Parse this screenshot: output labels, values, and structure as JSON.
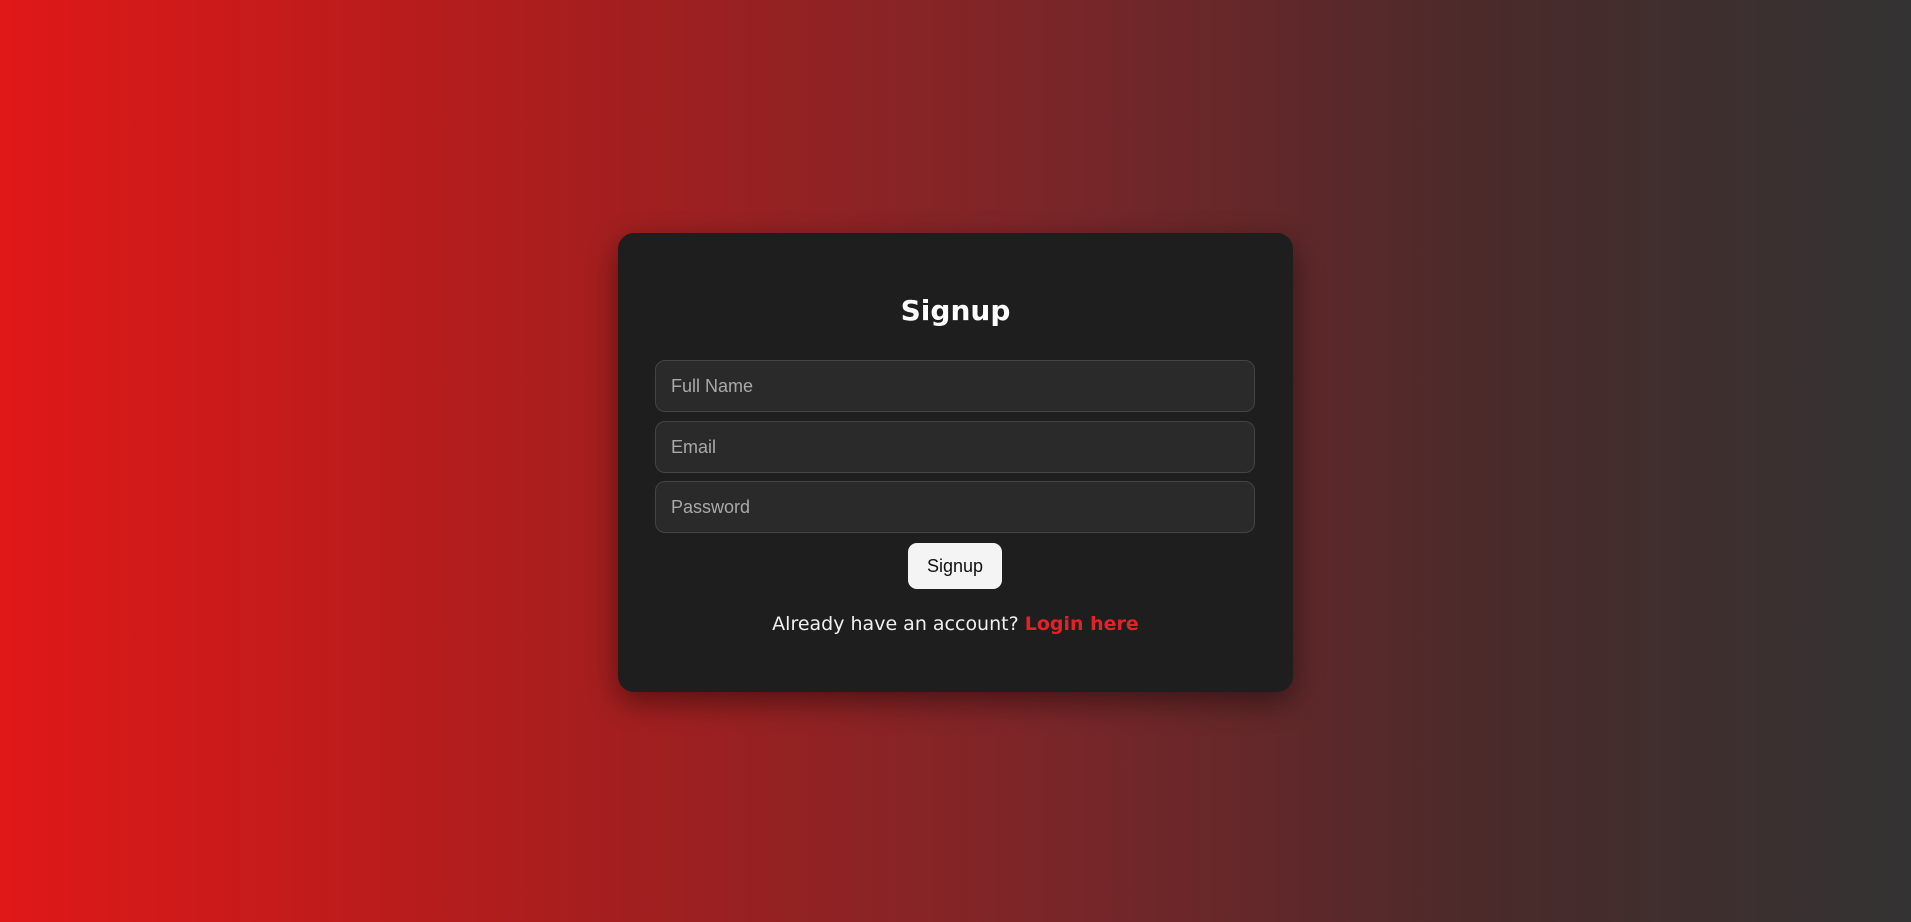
{
  "colors": {
    "gradient_start": "#e01818",
    "gradient_end": "#333333",
    "card_background": "#1e1e1e",
    "input_background": "#2a2a2a",
    "button_background": "#f4f4f4",
    "link_color": "#e3212a"
  },
  "signup": {
    "title": "Signup",
    "fields": [
      {
        "placeholder": "Full Name",
        "value": ""
      },
      {
        "placeholder": "Email",
        "value": ""
      },
      {
        "placeholder": "Password",
        "value": ""
      }
    ],
    "submit_label": "Signup",
    "footer_text": "Already have an account?",
    "login_link_label": "Login here"
  }
}
